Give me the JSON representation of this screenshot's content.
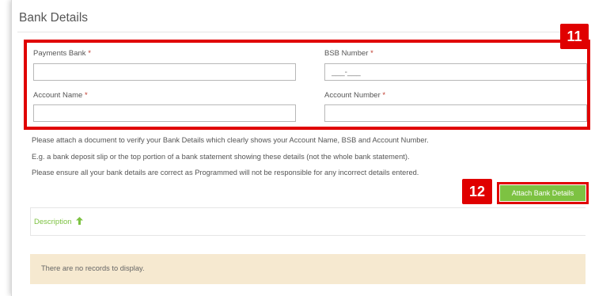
{
  "section": {
    "title": "Bank Details"
  },
  "form": {
    "payments_bank": {
      "label": "Payments Bank",
      "required_mark": "*",
      "value": ""
    },
    "bsb_number": {
      "label": "BSB Number",
      "required_mark": "*",
      "value": "___-___"
    },
    "account_name": {
      "label": "Account Name",
      "required_mark": "*",
      "value": ""
    },
    "account_number": {
      "label": "Account Number",
      "required_mark": "*",
      "value": ""
    }
  },
  "instructions": [
    "Please attach a document to verify your Bank Details which clearly shows your Account Name, BSB and Account Number.",
    "E.g. a bank deposit slip or the top portion of a bank statement showing these details (not the whole bank statement).",
    "Please ensure all your bank details are correct as Programmed will not be responsible for any incorrect details entered."
  ],
  "callouts": {
    "form_step": "11",
    "attach_step": "12"
  },
  "actions": {
    "attach_label": "Attach Bank Details"
  },
  "table": {
    "columns": [
      {
        "label": "Description",
        "sort": "ascending"
      }
    ],
    "empty_message": "There are no records to display."
  },
  "colors": {
    "accent_green": "#7dc242",
    "callout_red": "#e00000",
    "empty_row_bg": "#f6e9d0"
  }
}
